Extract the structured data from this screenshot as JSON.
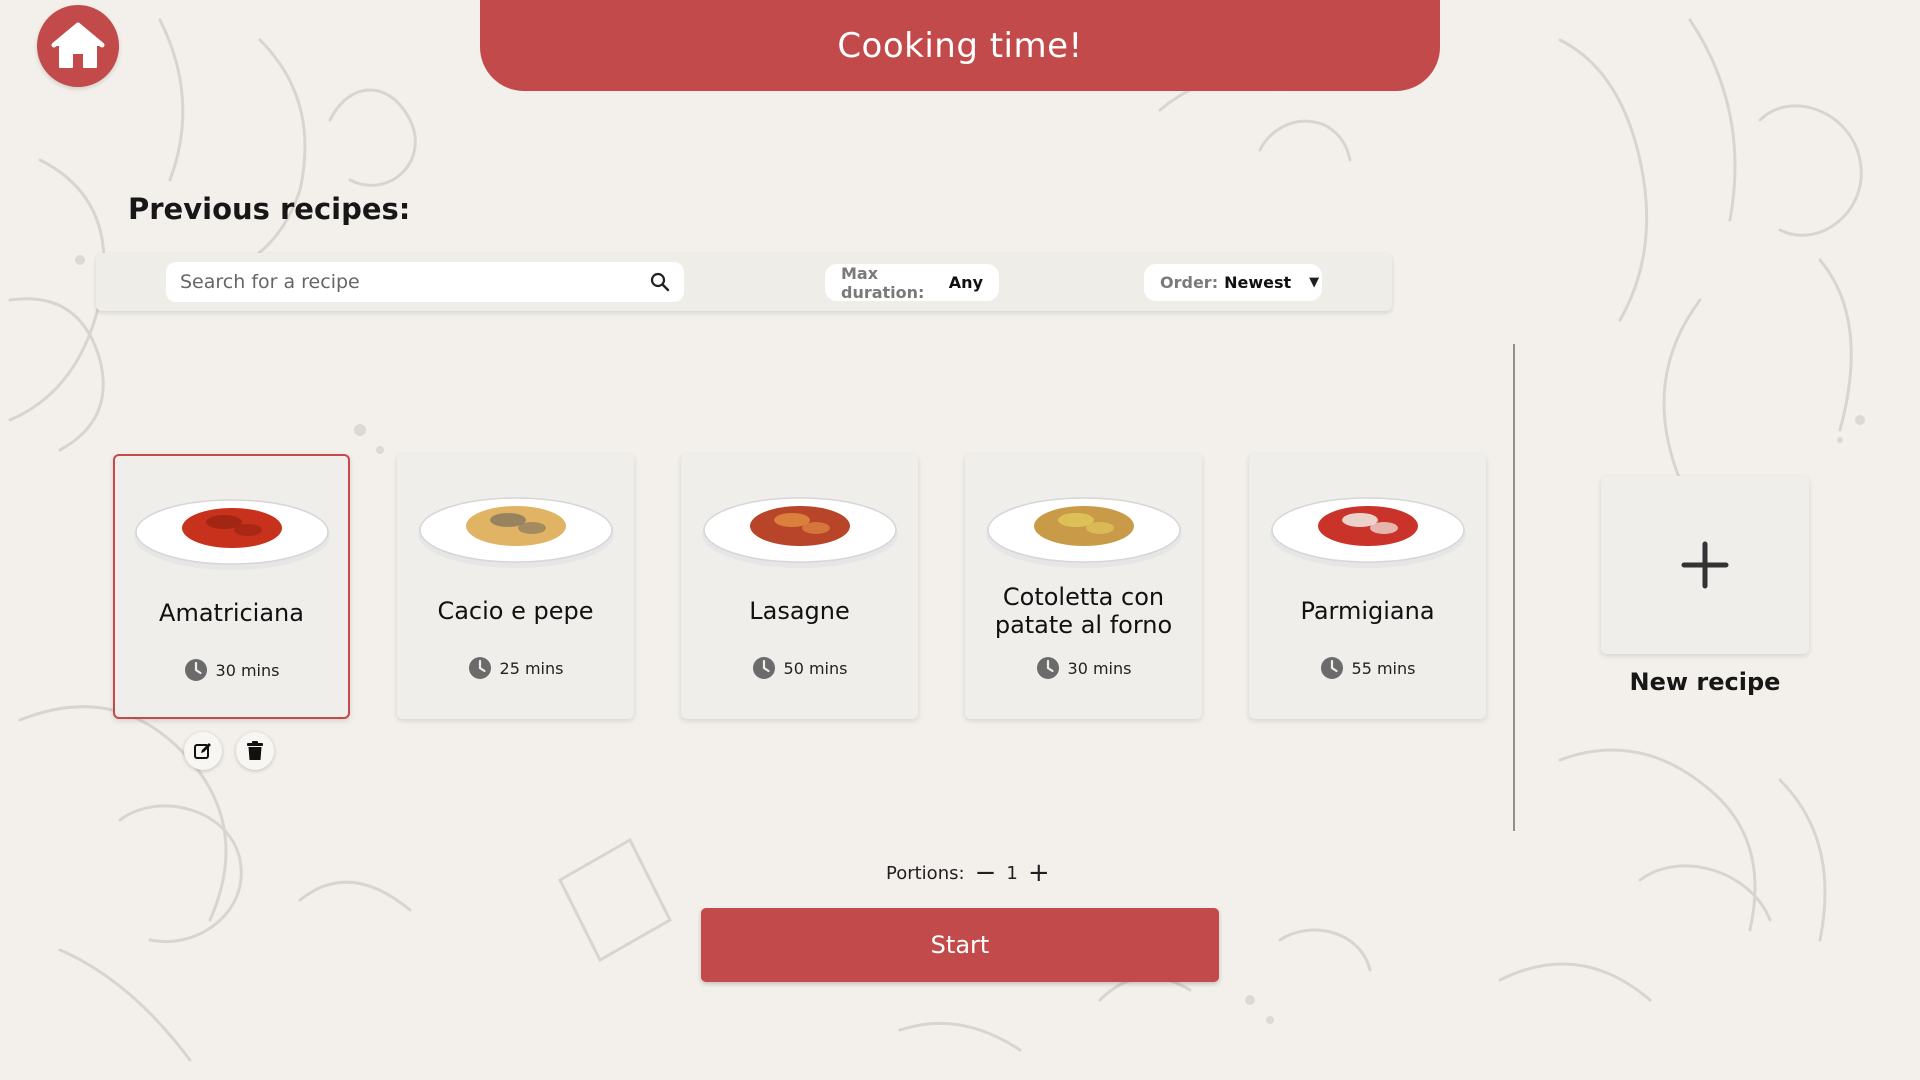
{
  "header": {
    "title": "Cooking time!",
    "home_icon": "home-icon",
    "accent_color": "#c24a4a"
  },
  "section_title": "Previous recipes:",
  "filters": {
    "search_placeholder": "Search for a recipe",
    "search_value": "",
    "max_duration_label": "Max duration:",
    "max_duration_value": "Any",
    "order_label": "Order:",
    "order_value": "Newest"
  },
  "recipes": [
    {
      "name": "Amatriciana",
      "time": "30 mins",
      "selected": true,
      "sauce": "#c8321c",
      "topping": "#9b2412"
    },
    {
      "name": "Cacio e pepe",
      "time": "25 mins",
      "selected": false,
      "sauce": "#e0b464",
      "topping": "#8a7a5e"
    },
    {
      "name": "Lasagne",
      "time": "50 mins",
      "selected": false,
      "sauce": "#b8442a",
      "topping": "#e08a40"
    },
    {
      "name": "Cotoletta con patate al forno",
      "time": "30 mins",
      "selected": false,
      "sauce": "#c99a48",
      "topping": "#e0c85a"
    },
    {
      "name": "Parmigiana",
      "time": "55 mins",
      "selected": false,
      "sauce": "#c9332a",
      "topping": "#f1eee6"
    }
  ],
  "selected_actions": {
    "edit_icon": "edit-icon",
    "delete_icon": "trash-icon"
  },
  "new_recipe": {
    "label": "New recipe",
    "icon": "plus-icon"
  },
  "portions": {
    "label": "Portions:",
    "value": "1",
    "decrement": "−",
    "increment": "+"
  },
  "start_label": "Start"
}
